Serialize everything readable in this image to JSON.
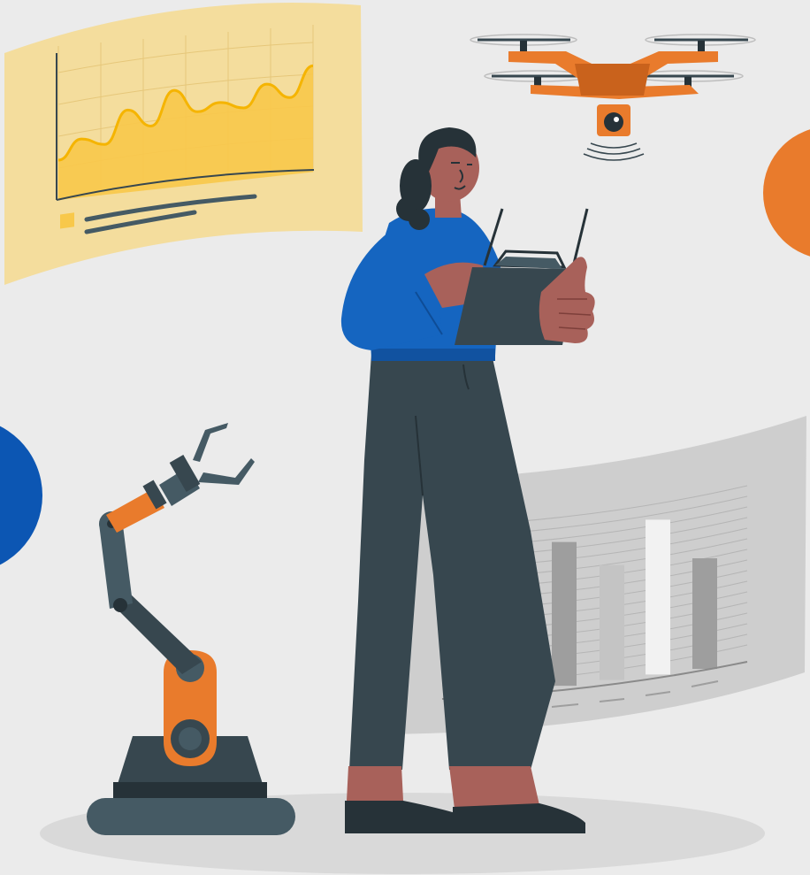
{
  "illustration": {
    "background": "#ebebeb",
    "palette": {
      "orange": "#e97b2c",
      "orange_dark": "#c9621c",
      "blue": "#0c56b3",
      "blue_sleeve": "#1565c0",
      "slate": "#37474f",
      "slate_dark": "#263238",
      "skin": "#a8615a",
      "yellow_panel": "#f4dd9d",
      "yellow_fill": "#f8c84a",
      "yellow_line": "#f5b400",
      "grey_panel": "#c9c9c9",
      "ground": "#d9d9d9"
    },
    "line_chart_panel": {
      "series_values": [
        30,
        44,
        38,
        62,
        48,
        73,
        55,
        60,
        54,
        70,
        58,
        80
      ]
    },
    "bar_chart_panel": {
      "bar_values": [
        0.3,
        0.55,
        0.65,
        0.52,
        0.7,
        0.5
      ]
    },
    "elements": [
      {
        "name": "drone",
        "icon": "drone-icon"
      },
      {
        "name": "robotic-arm",
        "icon": "robot-arm-icon"
      },
      {
        "name": "woman-with-controller",
        "icon": "person-icon"
      },
      {
        "name": "remote-controller",
        "icon": "controller-icon"
      }
    ]
  }
}
